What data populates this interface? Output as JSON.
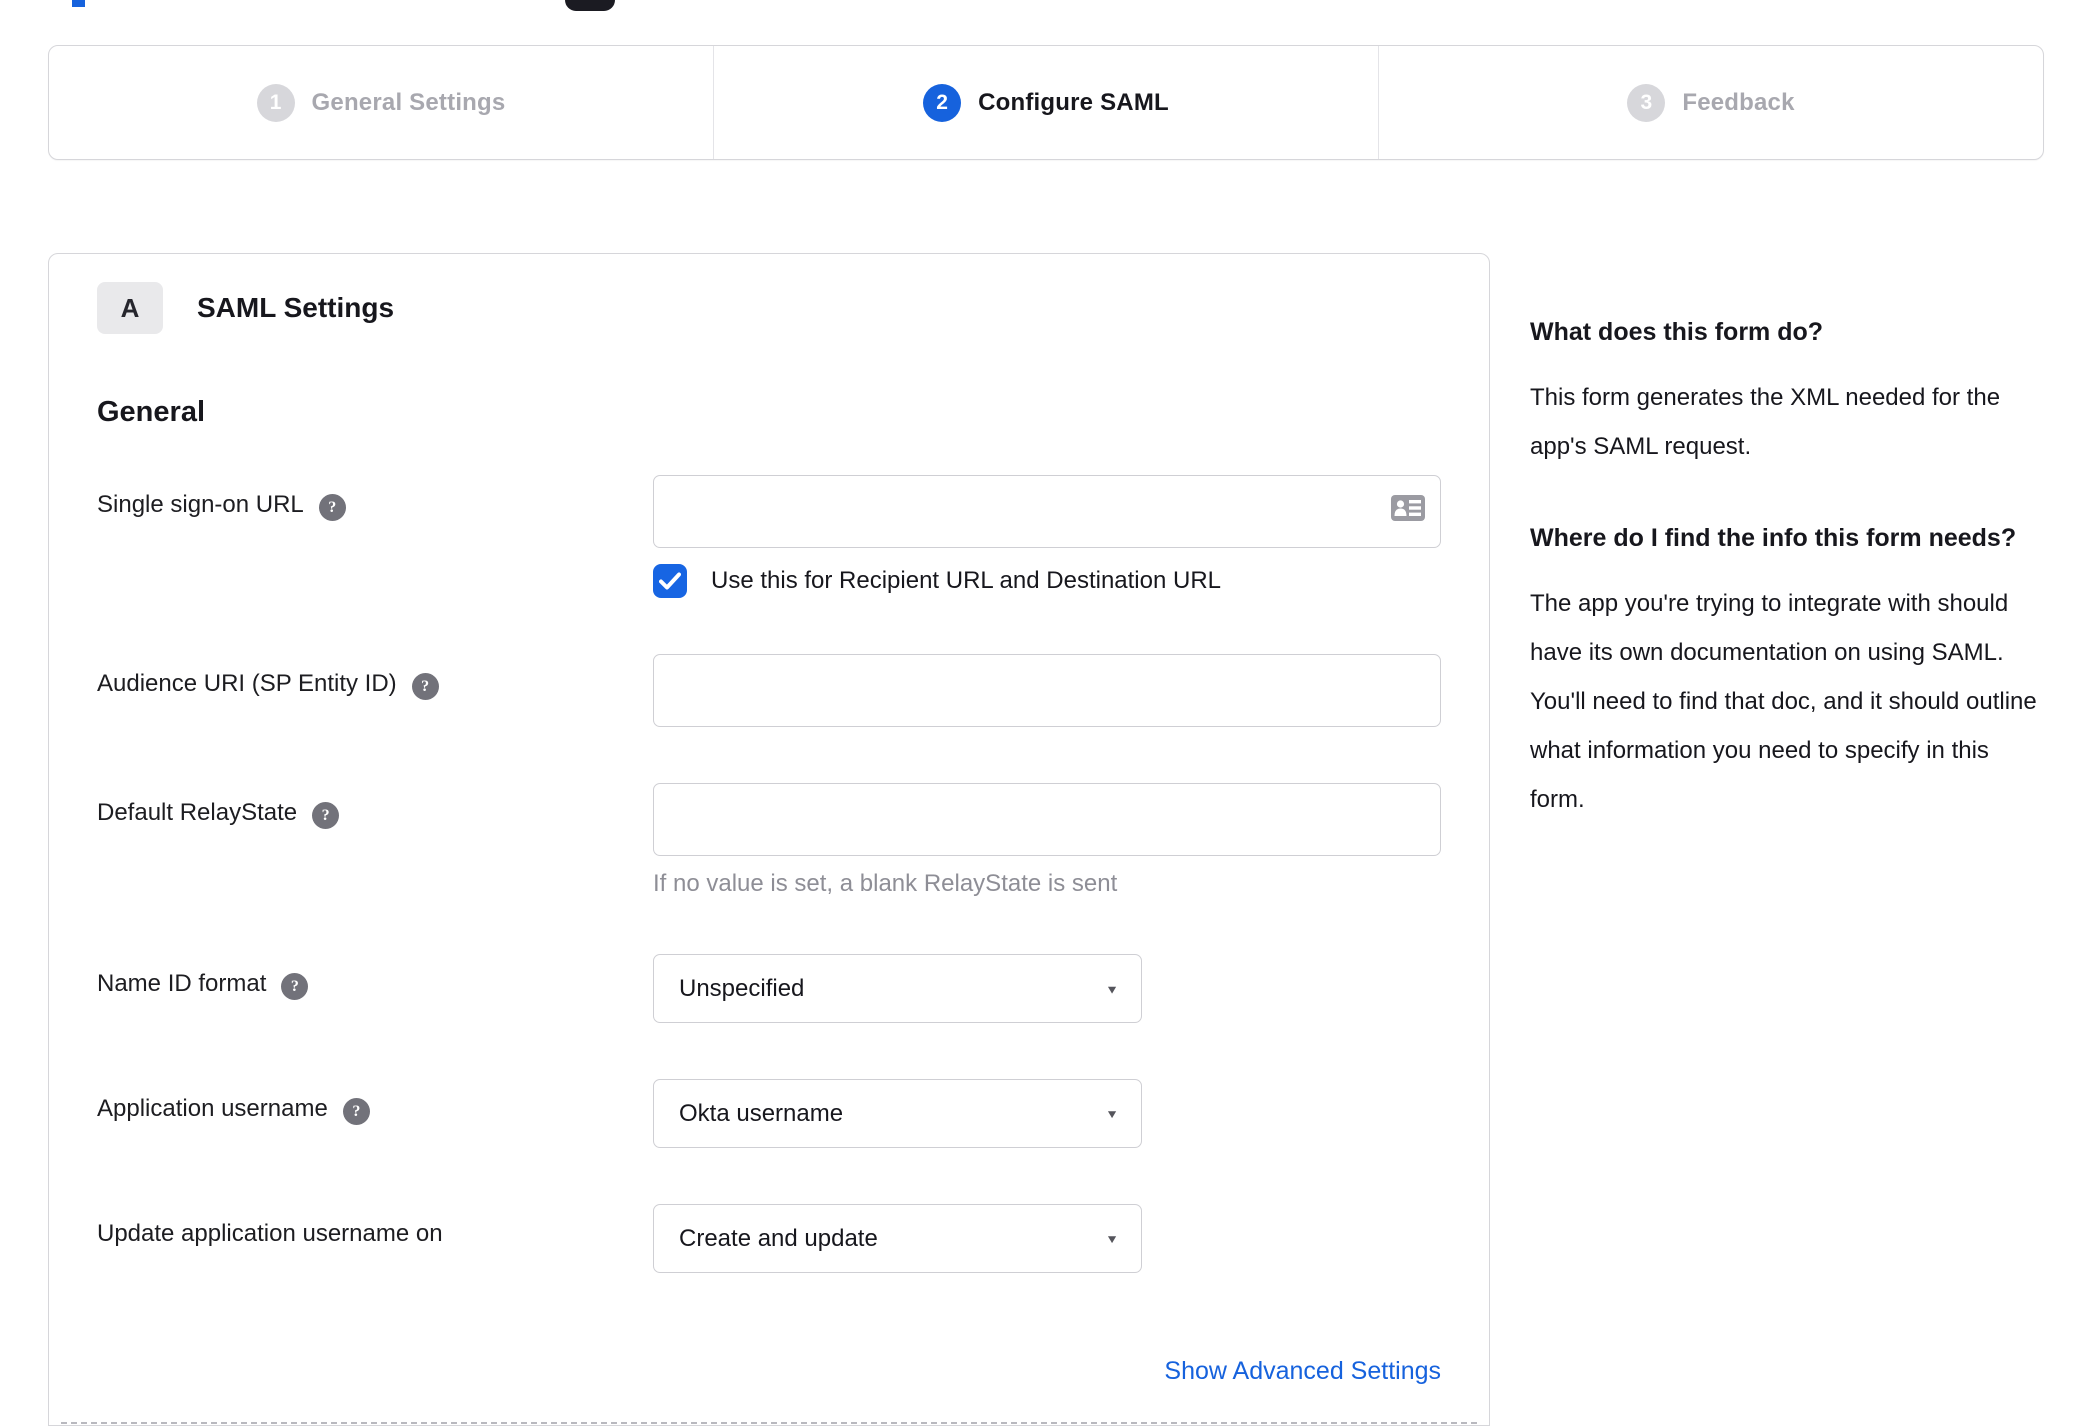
{
  "page": {
    "accent_blue": "#1662dd",
    "inactive_gray": "#d7d7db"
  },
  "stepper": {
    "steps": [
      {
        "number": "1",
        "label": "General Settings",
        "state": "inactive"
      },
      {
        "number": "2",
        "label": "Configure SAML",
        "state": "active"
      },
      {
        "number": "3",
        "label": "Feedback",
        "state": "inactive"
      }
    ]
  },
  "panel": {
    "section_badge": "A",
    "section_title": "SAML Settings",
    "group_title": "General",
    "fields": [
      {
        "label": "Single sign-on URL",
        "has_help": true,
        "type": "text",
        "value": "",
        "checkbox": {
          "checked": true,
          "label": "Use this for Recipient URL and Destination URL"
        }
      },
      {
        "label": "Audience URI (SP Entity ID)",
        "has_help": true,
        "type": "text",
        "value": ""
      },
      {
        "label": "Default RelayState",
        "has_help": true,
        "type": "text",
        "value": "",
        "hint": "If no value is set, a blank RelayState is sent"
      },
      {
        "label": "Name ID format",
        "has_help": true,
        "type": "select",
        "value": "Unspecified"
      },
      {
        "label": "Application username",
        "has_help": true,
        "type": "select",
        "value": "Okta username"
      },
      {
        "label": "Update application username on",
        "has_help": false,
        "type": "select",
        "value": "Create and update"
      }
    ],
    "help_icon_glyph": "?",
    "advanced_link": "Show Advanced Settings"
  },
  "help_panel": {
    "heading1": "What does this form do?",
    "para1": "This form generates the XML needed for the app's SAML request.",
    "heading2": "Where do I find the info this form needs?",
    "para2": "The app you're trying to integrate with should have its own documentation on using SAML. You'll need to find that doc, and it should outline what information you need to specify in this form."
  }
}
